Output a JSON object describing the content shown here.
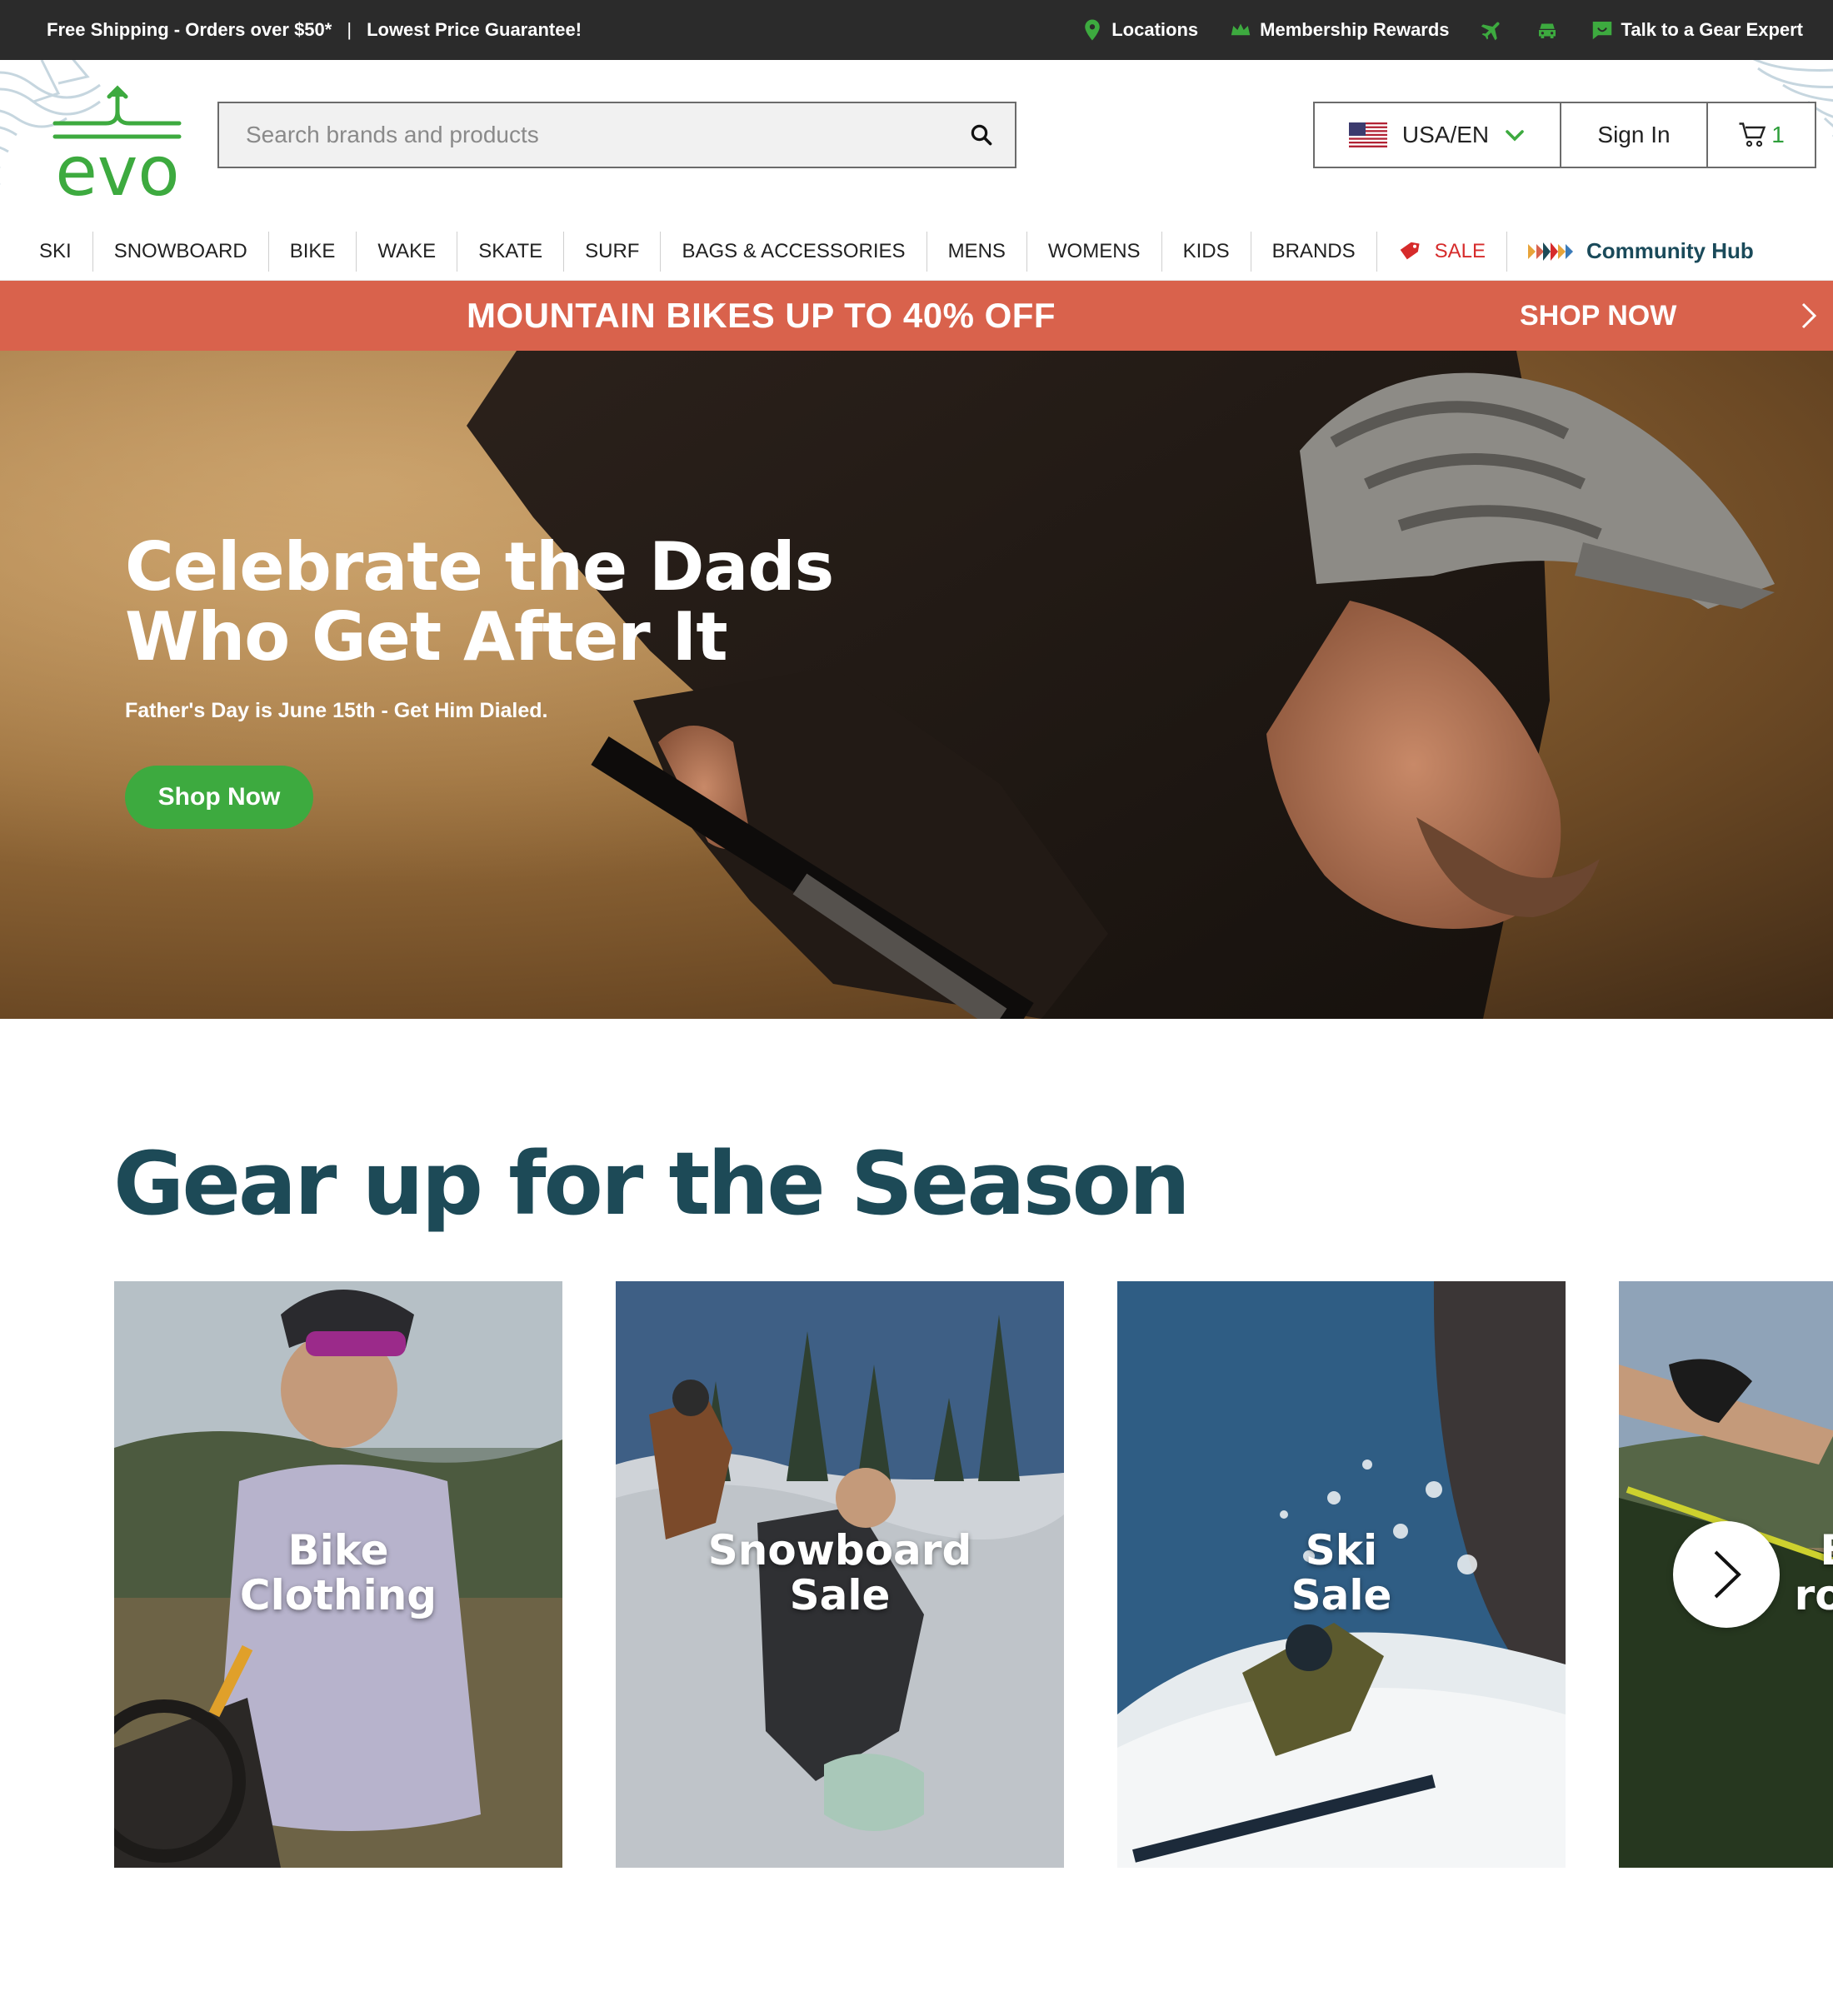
{
  "topbar": {
    "promo_shipping": "Free Shipping - Orders over $50*",
    "separator": "|",
    "promo_price": "Lowest Price Guarantee!",
    "locations": "Locations",
    "membership": "Membership Rewards",
    "gear_expert": "Talk to a Gear Expert",
    "icons": [
      "location-pin-icon",
      "crown-icon",
      "plane-icon",
      "car-icon",
      "chat-icon"
    ]
  },
  "header": {
    "logo_text": "evo",
    "search_placeholder": "Search brands and products",
    "region": "USA/EN",
    "sign_in": "Sign In",
    "cart_count": "1"
  },
  "nav": {
    "items": [
      "SKI",
      "SNOWBOARD",
      "BIKE",
      "WAKE",
      "SKATE",
      "SURF",
      "BAGS & ACCESSORIES",
      "MENS",
      "WOMENS",
      "KIDS",
      "BRANDS",
      "SALE",
      "Community Hub"
    ]
  },
  "promo_banner": {
    "text": "MOUNTAIN BIKES UP TO 40% OFF",
    "cta": "SHOP NOW"
  },
  "hero": {
    "title": "Celebrate the Dads Who Get After It",
    "subtitle": "Father's Day is June 15th - Get Him Dialed.",
    "cta": "Shop Now"
  },
  "section": {
    "title": "Gear up for the Season",
    "cards": [
      {
        "line1": "Bike",
        "line2": "Clothing"
      },
      {
        "line1": "Snowboard",
        "line2": "Sale"
      },
      {
        "line1": "Ski",
        "line2": "Sale"
      },
      {
        "line1": "Bi",
        "line2": "rote"
      }
    ]
  },
  "colors": {
    "brand_green": "#3daa3f",
    "promo_banner": "#d9624c",
    "heading_teal": "#1d4a57",
    "sale_red": "#d62b2b",
    "topbar": "#2b2b2b"
  }
}
